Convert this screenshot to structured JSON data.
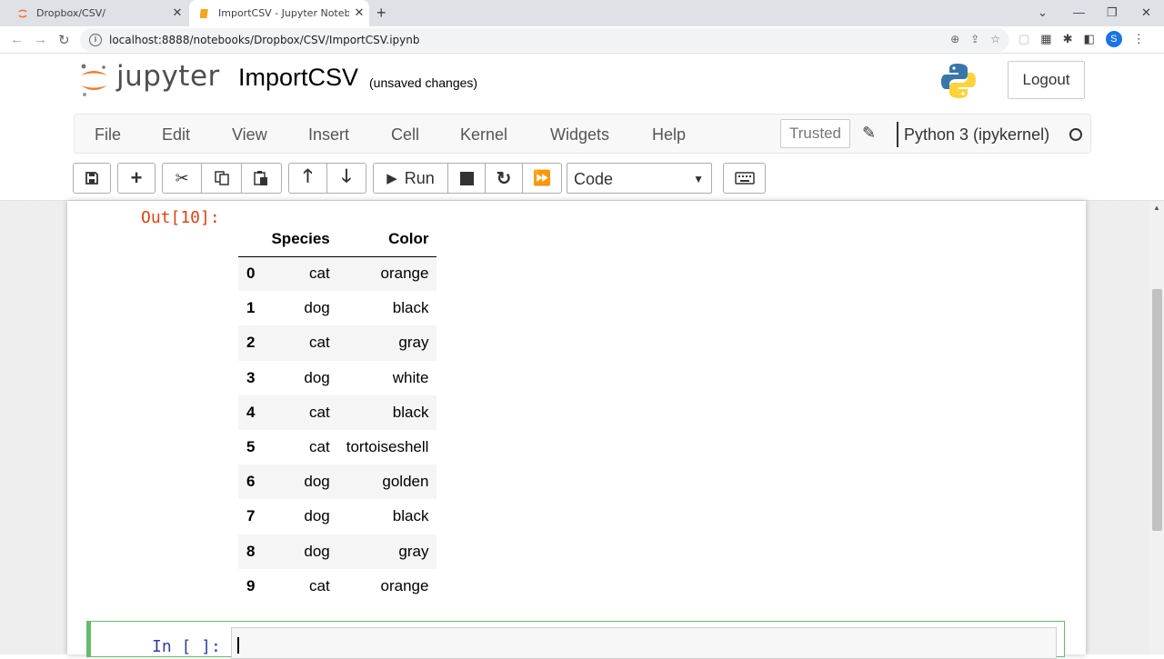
{
  "browser": {
    "tabs": [
      {
        "title": "Dropbox/CSV/",
        "icon": "jupyter-favicon",
        "active": false
      },
      {
        "title": "ImportCSV - Jupyter Notebook",
        "icon": "notebook-favicon",
        "active": true
      }
    ],
    "url": "localhost:8888/notebooks/Dropbox/CSV/ImportCSV.ipynb",
    "profile_initial": "S"
  },
  "header": {
    "logo_text": "jupyter",
    "notebook_name": "ImportCSV",
    "save_status": "(unsaved changes)",
    "logout_label": "Logout"
  },
  "menubar": {
    "items": [
      "File",
      "Edit",
      "View",
      "Insert",
      "Cell",
      "Kernel",
      "Widgets",
      "Help"
    ],
    "trusted_label": "Trusted",
    "kernel_name": "Python 3 (ipykernel)"
  },
  "toolbar": {
    "run_label": "Run",
    "cell_type": "Code"
  },
  "output": {
    "prompt": "Out[10]:",
    "columns": [
      "",
      "Species",
      "Color"
    ],
    "rows": [
      [
        "0",
        "cat",
        "orange"
      ],
      [
        "1",
        "dog",
        "black"
      ],
      [
        "2",
        "cat",
        "gray"
      ],
      [
        "3",
        "dog",
        "white"
      ],
      [
        "4",
        "cat",
        "black"
      ],
      [
        "5",
        "cat",
        "tortoiseshell"
      ],
      [
        "6",
        "dog",
        "golden"
      ],
      [
        "7",
        "dog",
        "black"
      ],
      [
        "8",
        "dog",
        "gray"
      ],
      [
        "9",
        "cat",
        "orange"
      ]
    ]
  },
  "input_cell": {
    "prompt": "In [ ]:"
  },
  "colors": {
    "out_prompt": "#d84315",
    "in_prompt": "#303f9f",
    "active_cell_border": "#66bb6a"
  }
}
